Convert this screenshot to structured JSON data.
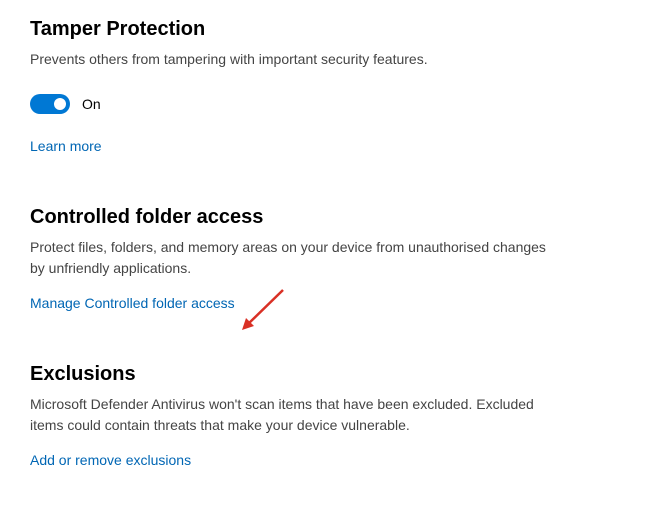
{
  "tamper": {
    "title": "Tamper Protection",
    "description": "Prevents others from tampering with important security features.",
    "toggle_state": "On",
    "toggle_on": true,
    "link": "Learn more"
  },
  "controlled_folder": {
    "title": "Controlled folder access",
    "description": "Protect files, folders, and memory areas on your device from unauthorised changes by unfriendly applications.",
    "link": "Manage Controlled folder access"
  },
  "exclusions": {
    "title": "Exclusions",
    "description": "Microsoft Defender Antivirus won't scan items that have been excluded. Excluded items could contain threats that make your device vulnerable.",
    "link": "Add or remove exclusions"
  }
}
